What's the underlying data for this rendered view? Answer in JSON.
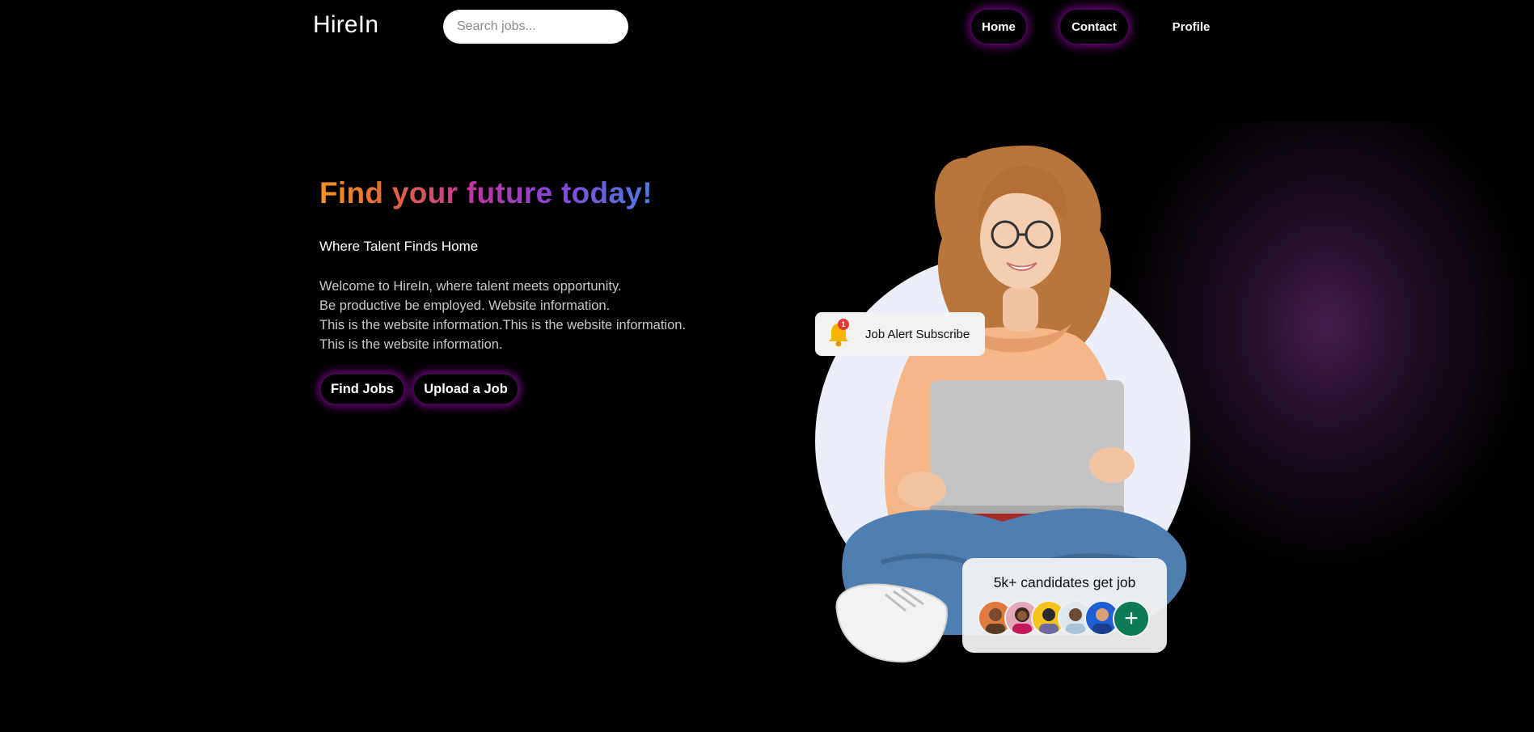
{
  "header": {
    "logo": "HireIn",
    "search_placeholder": "Search jobs...",
    "nav": {
      "home": "Home",
      "contact": "Contact",
      "profile": "Profile"
    }
  },
  "hero": {
    "title": "Find your future today!",
    "tagline": "Where Talent Finds Home",
    "description": [
      "Welcome to HireIn, where talent meets opportunity.",
      "Be productive be employed. Website information.",
      "This is the website information.This is the website information.",
      "This is the website information."
    ],
    "buttons": {
      "find_jobs": "Find Jobs",
      "upload_job": "Upload a Job"
    }
  },
  "illustration": {
    "alert_card": {
      "label": "Job Alert Subscribe",
      "badge_count": "1",
      "icon": "bell-icon"
    },
    "candidates_card": {
      "title": "5k+ candidates get job",
      "plus_icon": "+"
    }
  },
  "colors": {
    "background": "#000000",
    "glow": "#9600aa",
    "accent_green": "#0b7a55",
    "title_gradient": [
      "#f7941d",
      "#c0359e",
      "#4a7ce0"
    ]
  }
}
